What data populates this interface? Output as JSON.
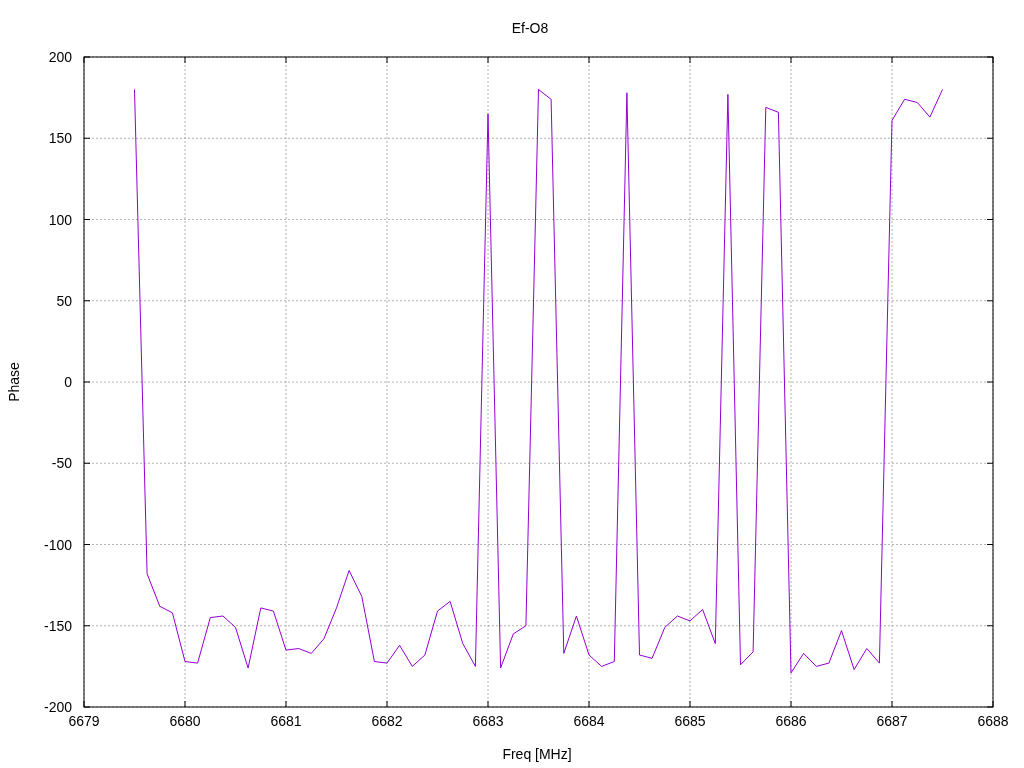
{
  "chart_data": {
    "type": "line",
    "title": "Ef-O8",
    "xlabel": "Freq [MHz]",
    "ylabel": "Phase",
    "x": [
      6679.5,
      6679.625,
      6679.75,
      6679.875,
      6680,
      6680.125,
      6680.25,
      6680.375,
      6680.5,
      6680.625,
      6680.75,
      6680.875,
      6681,
      6681.125,
      6681.25,
      6681.375,
      6681.5,
      6681.625,
      6681.75,
      6681.875,
      6682,
      6682.125,
      6682.25,
      6682.375,
      6682.5,
      6682.625,
      6682.75,
      6682.875,
      6683,
      6683.125,
      6683.25,
      6683.375,
      6683.5,
      6683.625,
      6683.75,
      6683.875,
      6684,
      6684.125,
      6684.25,
      6684.375,
      6684.5,
      6684.625,
      6684.75,
      6684.875,
      6685,
      6685.125,
      6685.25,
      6685.375,
      6685.5,
      6685.625,
      6685.75,
      6685.875,
      6686,
      6686.125,
      6686.25,
      6686.375,
      6686.5,
      6686.625,
      6686.75,
      6686.875,
      6687,
      6687.125,
      6687.25,
      6687.375,
      6687.5
    ],
    "series": [
      {
        "color": "#9400d3",
        "values": [
          180,
          -118,
          -138,
          -142,
          -172,
          -173,
          -145,
          -144,
          -151,
          -176,
          -139,
          -141,
          -165,
          -164,
          -167,
          -158,
          -139,
          -116,
          -132,
          -172,
          -173,
          -162,
          -175,
          -168,
          -141,
          -135,
          -161,
          -175,
          165,
          -176,
          -155,
          -150,
          180,
          174,
          -167,
          -144,
          -168,
          -175,
          -172,
          178,
          -168,
          -170,
          -151,
          -144,
          -147,
          -140,
          -161,
          177,
          -174,
          -166,
          169,
          166,
          -179,
          -167,
          -175,
          -173,
          -153,
          -177,
          -164,
          -173,
          161,
          174,
          172,
          163,
          180
        ]
      }
    ],
    "grid": true,
    "xlim": [
      6679,
      6688
    ],
    "ylim": [
      -200,
      200
    ],
    "xticks": [
      6679,
      6680,
      6681,
      6682,
      6683,
      6684,
      6685,
      6686,
      6687,
      6688
    ],
    "yticks": [
      -200,
      -150,
      -100,
      -50,
      0,
      50,
      100,
      150,
      200
    ]
  }
}
